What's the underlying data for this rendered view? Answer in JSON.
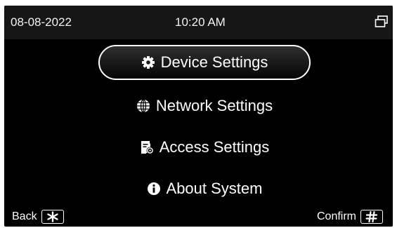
{
  "status": {
    "date": "08-08-2022",
    "time": "10:20 AM",
    "icon": "window-switch-icon"
  },
  "menu": {
    "selected_index": 0,
    "items": [
      {
        "label": "Device Settings",
        "icon": "gear-icon"
      },
      {
        "label": "Network Settings",
        "icon": "globe-icon"
      },
      {
        "label": "Access Settings",
        "icon": "access-card-icon"
      },
      {
        "label": "About System",
        "icon": "info-icon"
      }
    ]
  },
  "footer": {
    "back_label": "Back",
    "back_key_icon": "star-key-icon",
    "confirm_label": "Confirm",
    "confirm_key_icon": "hash-key-icon"
  },
  "colors": {
    "background": "#000000",
    "status_bar": "#161616",
    "text": "#ffffff",
    "selection_border": "#ffffff"
  }
}
